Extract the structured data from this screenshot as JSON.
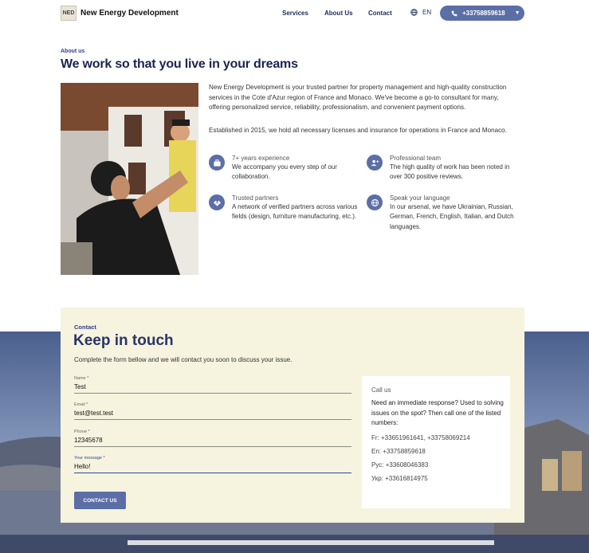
{
  "header": {
    "logo_text": "NED",
    "brand": "New Energy Development",
    "nav": [
      "Services",
      "About Us",
      "Contact"
    ],
    "lang": "EN",
    "phone": "+33758859618"
  },
  "about": {
    "kicker": "About us",
    "title": "We work so that you live in your dreams",
    "p1": "New Energy Development is your trusted partner for property management and high-quality construction services in the Cote d'Azur region of France and Monaco. We've become a go-to consultant for many, offering personalized service, reliability, professionalism, and convenient payment options.",
    "p2": "Established in 2015, we hold all necessary licenses and insurance for operations in France and Monaco.",
    "features": [
      {
        "title": "7+ years experience",
        "text": "We accompany you every step of our collaboration.",
        "icon": "briefcase-icon"
      },
      {
        "title": "Professional team",
        "text": "The high quality of work has been noted in over 300 positive reviews.",
        "icon": "team-icon"
      },
      {
        "title": "Trusted partners",
        "text": "A network of verified partners across various fields (design, furniture manufacturing, etc.).",
        "icon": "handshake-icon"
      },
      {
        "title": "Speak your language",
        "text": "In our arsenal, we have Ukrainian, Russian, German, French, English, Italian, and Dutch languages.",
        "icon": "globe-icon"
      }
    ]
  },
  "contact": {
    "kicker": "Contact",
    "title": "Keep in touch",
    "subtitle": "Complete the form bellow and we will contact you soon to discuss your issue.",
    "fields": [
      {
        "label": "Name *",
        "value": "Test"
      },
      {
        "label": "Email *",
        "value": "test@test.test"
      },
      {
        "label": "Phone *",
        "value": "12345678"
      },
      {
        "label": "Your message *",
        "value": "Hello!"
      }
    ],
    "submit": "CONTACT US",
    "call": {
      "heading": "Call us",
      "text": "Need an immediate response? Used to solving issues on the spot? Then call one of the listed numbers:",
      "lines": [
        "Fr: +33651961641, +33758069214",
        "En: +33758859618",
        "Рус: +33608046383",
        "Укр: +33616814975"
      ]
    }
  },
  "colors": {
    "accent": "#5b6ea6",
    "title": "#1b2350",
    "card": "#f6f3df"
  }
}
